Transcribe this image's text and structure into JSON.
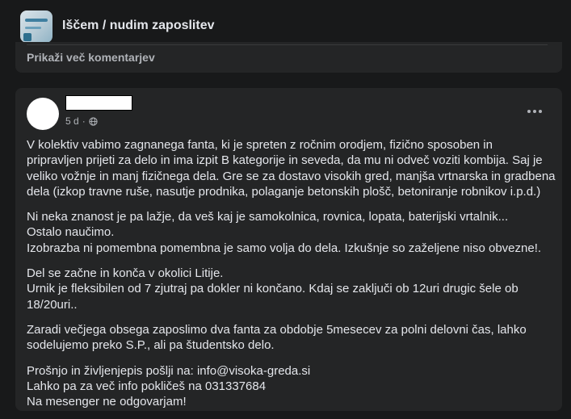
{
  "group": {
    "title": "Iščem / nudim zaposlitev"
  },
  "previous_post": {
    "show_more_comments": "Prikaži več komentarjev"
  },
  "post": {
    "author_redacted": true,
    "time": "5 d",
    "audience_icon": "globe-icon",
    "menu_icon": "more-options-icon",
    "paragraphs": [
      {
        "lines": [
          "V kolektiv vabimo zagnanega fanta, ki je spreten z ročnim orodjem, fizično sposoben in",
          "pripravljen prijeti za delo in ima izpit B kategorije in seveda, da mu ni odveč voziti kombija. Saj je",
          "veliko vožnje in manj fizičnega dela.  Gre se za dostavo visokih gred, manjša vrtnarska in gradbena",
          "dela (izkop travne ruše, nasutje prodnika, polaganje betonskih plošč, betoniranje robnikov i.p.d.)"
        ]
      },
      {
        "lines": [
          "Ni neka znanost je pa lažje, da veš kaj je samokolnica, rovnica, lopata, baterijski vrtalnik...",
          "Ostalo naučimo.",
          "Izobrazba ni pomembna pomembna je samo volja do dela. Izkušnje so zaželjene niso obvezne!."
        ]
      },
      {
        "lines": [
          "Del se začne in konča v okolici Litije.",
          "Urnik je fleksibilen od 7 zjutraj pa dokler ni končano. Kdaj se zaključi ob 12uri drugic šele ob",
          "18/20uri.."
        ]
      },
      {
        "lines": [
          "Zaradi večjega obsega zaposlimo dva fanta za obdobje 5mesecev za polni delovni čas, lahko",
          "sodelujemo preko S.P., ali pa študentsko delo."
        ]
      },
      {
        "lines": [
          "Prošnjo in življenjepis pošlji na: info@visoka-greda.si",
          "Lahko pa za več info pokličeš na 031337684",
          "Na mesenger ne odgovarjam!"
        ]
      }
    ]
  },
  "colors": {
    "background": "#18191a",
    "card": "#242526",
    "text_primary": "#e4e6eb",
    "text_secondary": "#b0b3b8"
  }
}
